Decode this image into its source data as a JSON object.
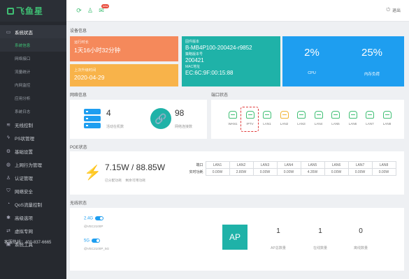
{
  "app": {
    "logo_text": "飞鱼星"
  },
  "sidebar": {
    "items": [
      {
        "label": "系统状态",
        "icon": "monitor-icon",
        "group": true
      },
      {
        "label": "系统信息",
        "sub": true,
        "active": true
      },
      {
        "label": "网络接口",
        "sub": true
      },
      {
        "label": "流量统计",
        "sub": true
      },
      {
        "label": "内网监控",
        "sub": true
      },
      {
        "label": "应用分析",
        "sub": true
      },
      {
        "label": "系统日志",
        "sub": true
      },
      {
        "label": "无线控制",
        "icon": "wifi-icon"
      },
      {
        "label": "PS状管理",
        "icon": "lightning-icon"
      },
      {
        "label": "基础设置",
        "icon": "gear-icon"
      },
      {
        "label": "上网行为管理",
        "icon": "globe-icon"
      },
      {
        "label": "认证管理",
        "icon": "user-icon"
      },
      {
        "label": "网络安全",
        "icon": "shield-icon"
      },
      {
        "label": "QoS流量控制",
        "icon": "gauge-icon"
      },
      {
        "label": "高级选项",
        "icon": "settings-icon"
      },
      {
        "label": "虚拟专网",
        "icon": "vpn-icon"
      },
      {
        "label": "系统工具",
        "icon": "toolbox-icon"
      }
    ],
    "hotline": "客服热线：400-837-6665"
  },
  "topbar": {
    "badge": "new",
    "logout_label": "退出"
  },
  "device_info": {
    "section_title": "设备信息",
    "uptime_label": "运行时长",
    "uptime_value": "1天16小时32分钟",
    "update_label": "上次升级时间",
    "update_value": "2020-04-29",
    "firmware_label": "固件版本",
    "firmware_value": "B-MB4P100-200424-r9852",
    "hardware_label": "策略版本号",
    "hardware_value": "200421",
    "mac_label": "MAC地址",
    "mac_value": "EC:6C:9F:00:15:88",
    "cpu_value": "2%",
    "cpu_label": "CPU",
    "mem_value": "25%",
    "mem_label": "内存负荷"
  },
  "network_info": {
    "section_title": "网络信息",
    "online_count": "4",
    "online_label": "活动在机数",
    "conn_count": "98",
    "conn_label": "网络连接数"
  },
  "port_status": {
    "section_title": "端口状态",
    "ports": [
      {
        "name": "WAN1",
        "color": "#3fbf74"
      },
      {
        "name": "IPTV",
        "color": "#3fbf74"
      },
      {
        "name": "LAN1",
        "color": "#3fbf74"
      },
      {
        "name": "LAN2",
        "color": "#f2b230"
      },
      {
        "name": "LAN3",
        "color": "#3fbf74"
      },
      {
        "name": "LAN4",
        "color": "#3fbf74"
      },
      {
        "name": "LAN5",
        "color": "#3fbf74"
      },
      {
        "name": "LAN6",
        "color": "#3fbf74"
      },
      {
        "name": "LAN7",
        "color": "#3fbf74"
      },
      {
        "name": "LAN8",
        "color": "#3fbf74"
      }
    ]
  },
  "poe": {
    "section_title": "POE状态",
    "power": "7.15W / 88.85W",
    "used_label": "已分配功耗",
    "remain_label": "剩余可用功耗",
    "header_label": "端口",
    "row_label": "实时功耗",
    "ports": [
      "LAN1",
      "LAN2",
      "LAN3",
      "LAN4",
      "LAN5",
      "LAN6",
      "LAN7",
      "LAN8"
    ],
    "values": [
      "0.00W",
      "2.80W",
      "0.00W",
      "0.00W",
      "4.35W",
      "0.00W",
      "0.00W",
      "0.00W"
    ]
  },
  "wireless": {
    "section_title": "无线状态",
    "band1": "2.4G",
    "ssid1": "@VEC2100P",
    "band2": "5G",
    "ssid2": "@VEC2100P_5G",
    "ap_label": "AP",
    "ap_count": "1",
    "ap_count_label": "AP总数量",
    "online_count": "1",
    "online_label": "在线数量",
    "offline_count": "0",
    "offline_label": "离线数量"
  },
  "colors": {
    "accent": "#3fbf74",
    "sidebar_bg": "#26292f",
    "orange": "#f5895b",
    "amber": "#f8b34a",
    "teal": "#1fb2a8",
    "blue": "#1e9ef0"
  }
}
